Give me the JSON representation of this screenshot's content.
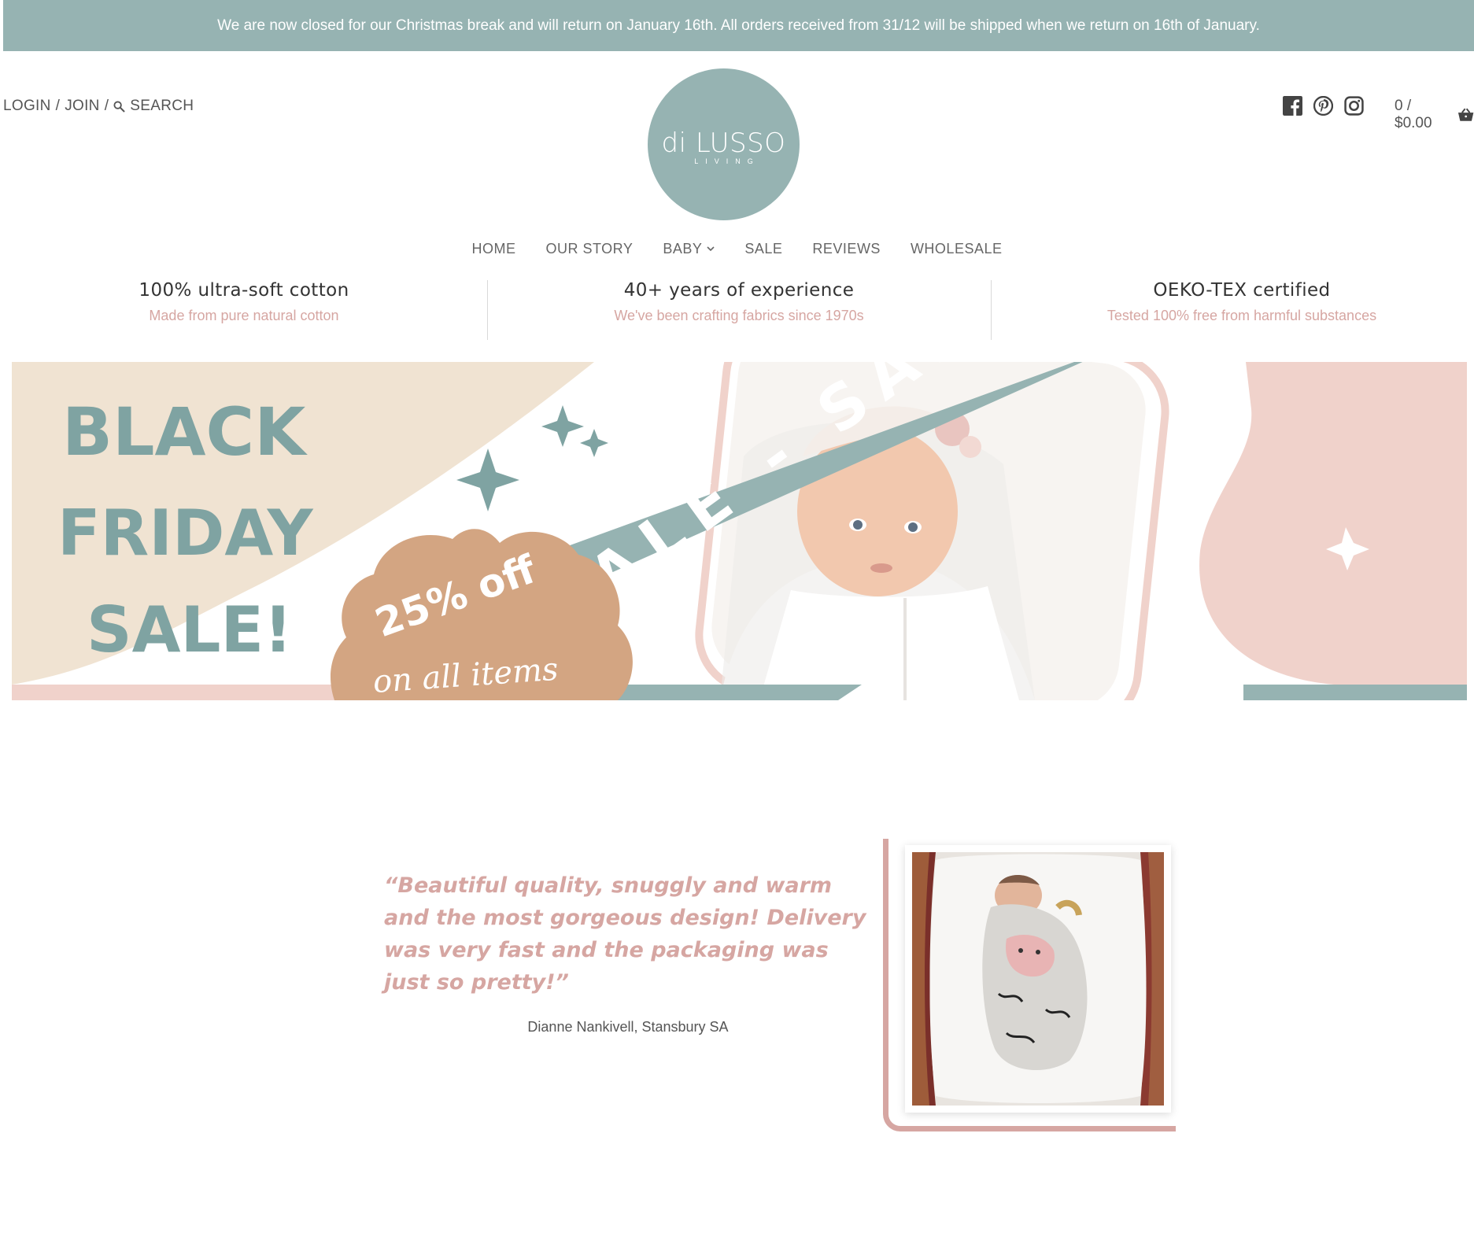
{
  "announcement": "We are now closed for our Christmas break and will return on January 16th. All orders received from 31/12 will be shipped when we return on 16th of January.",
  "header": {
    "login": "LOGIN",
    "join": "JOIN",
    "sep": "/",
    "search": "SEARCH",
    "logo_main": "di LUSSO",
    "logo_sub": "LIVING",
    "cart": "0 / $0.00",
    "social_icons": [
      "facebook-icon",
      "pinterest-icon",
      "instagram-icon"
    ]
  },
  "nav": {
    "items": [
      {
        "label": "HOME"
      },
      {
        "label": "OUR STORY"
      },
      {
        "label": "BABY",
        "dropdown": true
      },
      {
        "label": "SALE"
      },
      {
        "label": "REVIEWS"
      },
      {
        "label": "WHOLESALE"
      }
    ]
  },
  "features": [
    {
      "title": "100% ultra-soft cotton",
      "desc": "Made from pure natural cotton"
    },
    {
      "title": "40+ years of experience",
      "desc": "We've been crafting fabrics since 1970s"
    },
    {
      "title": "OEKO-TEX certified",
      "desc": "Tested 100% free from harmful substances"
    }
  ],
  "banner": {
    "line1": "BLACK",
    "line2": "FRIDAY",
    "line3": "SALE!",
    "badge_pct": "25% off",
    "badge_sub": "on all items",
    "ribbon": "ALE - SALE"
  },
  "testimonial": {
    "quote": "“Beautiful quality, snuggly and warm and the most gorgeous design! Delivery was very fast and the packaging was just so pretty!”",
    "author": "Dianne Nankivell, Stansbury SA"
  },
  "colors": {
    "teal": "#96b3b2",
    "pink": "#d6a6a2",
    "cream": "#f0e3d2",
    "tan": "#d3a582",
    "blush": "#f0d2cb"
  }
}
